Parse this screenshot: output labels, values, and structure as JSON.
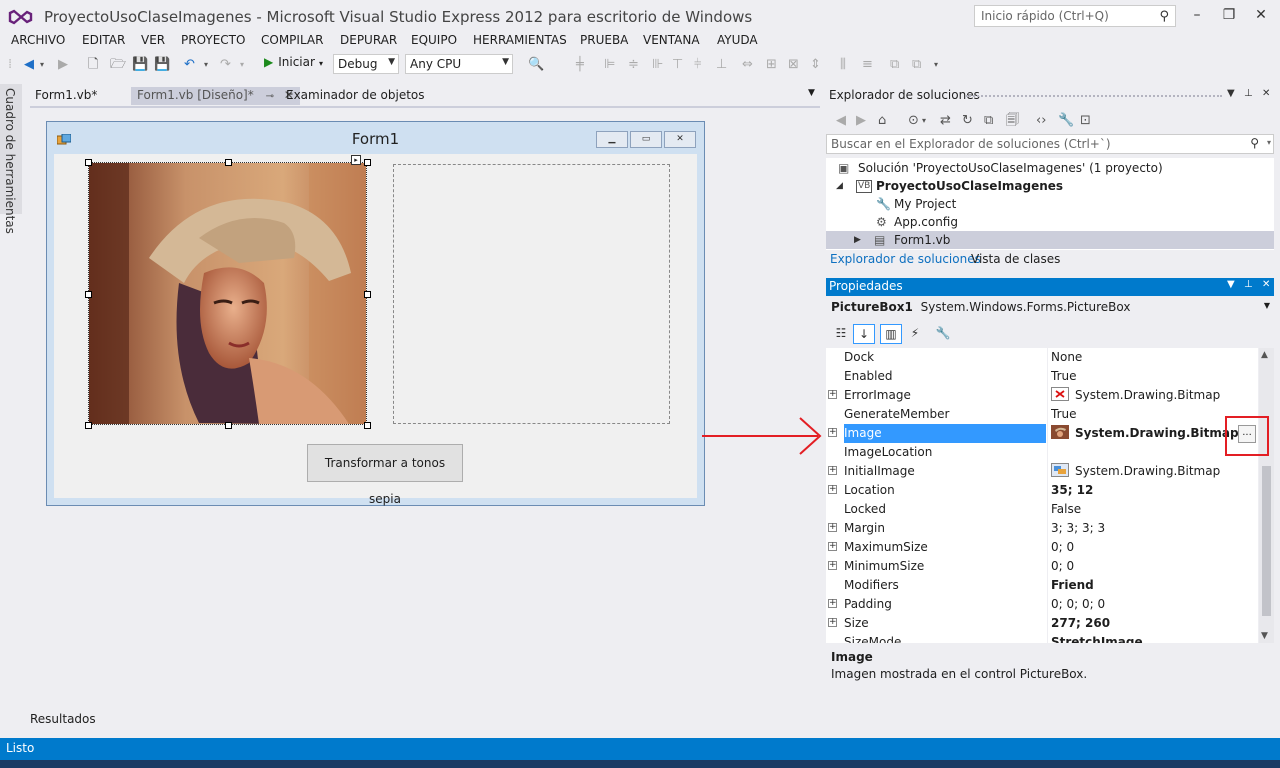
{
  "window": {
    "title": "ProyectoUsoClaseImagenes - Microsoft Visual Studio Express 2012 para escritorio de Windows",
    "quick_launch_placeholder": "Inicio rápido (Ctrl+Q)"
  },
  "menu": [
    "ARCHIVO",
    "EDITAR",
    "VER",
    "PROYECTO",
    "COMPILAR",
    "DEPURAR",
    "EQUIPO",
    "HERRAMIENTAS",
    "PRUEBA",
    "VENTANA",
    "AYUDA"
  ],
  "toolbar": {
    "start_label": "Iniciar",
    "config": "Debug",
    "platform": "Any CPU"
  },
  "toolbox_tab": "Cuadro de herramientas",
  "doc_tabs": [
    "Form1.vb*",
    "Form1.vb [Diseño]*",
    "Examinador de objetos"
  ],
  "form": {
    "title": "Form1",
    "button_label": "Transformar a tonos sepia"
  },
  "solution_explorer": {
    "title": "Explorador de soluciones",
    "search_placeholder": "Buscar en el Explorador de soluciones (Ctrl+`)",
    "items": [
      {
        "label": "Solución 'ProyectoUsoClaseImagenes'  (1 proyecto)",
        "icon": "solution-icon"
      },
      {
        "label": "ProyectoUsoClaseImagenes",
        "icon": "vb-project-icon"
      },
      {
        "label": "My Project",
        "icon": "wrench-icon"
      },
      {
        "label": "App.config",
        "icon": "config-icon"
      },
      {
        "label": "Form1.vb",
        "icon": "form-icon"
      }
    ],
    "tabs": [
      "Explorador de soluciones",
      "Vista de clases"
    ]
  },
  "properties": {
    "title": "Propiedades",
    "object_name": "PictureBox1",
    "object_type": "System.Windows.Forms.PictureBox",
    "rows": [
      {
        "name": "Dock",
        "value": "None"
      },
      {
        "name": "Enabled",
        "value": "True"
      },
      {
        "name": "ErrorImage",
        "value": "System.Drawing.Bitmap"
      },
      {
        "name": "GenerateMember",
        "value": "True"
      },
      {
        "name": "Image",
        "value": "System.Drawing.Bitmap"
      },
      {
        "name": "ImageLocation",
        "value": ""
      },
      {
        "name": "InitialImage",
        "value": "System.Drawing.Bitmap"
      },
      {
        "name": "Location",
        "value": "35; 12"
      },
      {
        "name": "Locked",
        "value": "False"
      },
      {
        "name": "Margin",
        "value": "3; 3; 3; 3"
      },
      {
        "name": "MaximumSize",
        "value": "0; 0"
      },
      {
        "name": "MinimumSize",
        "value": "0; 0"
      },
      {
        "name": "Modifiers",
        "value": "Friend"
      },
      {
        "name": "Padding",
        "value": "0; 0; 0; 0"
      },
      {
        "name": "Size",
        "value": "277; 260"
      },
      {
        "name": "SizeMode",
        "value": "StretchImage"
      }
    ],
    "ellipsis": "...",
    "desc_title": "Image",
    "desc_text": "Imagen mostrada en el control PictureBox."
  },
  "results_tab": "Resultados",
  "status": "Listo",
  "colors": {
    "accent": "#007acc",
    "selection": "#3399ff",
    "annotation": "#e31e24"
  }
}
